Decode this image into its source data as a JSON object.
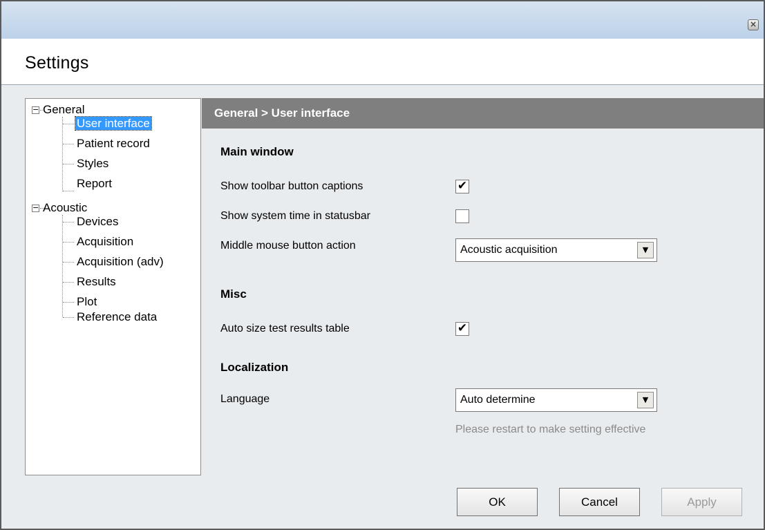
{
  "window": {
    "header_title": "Settings",
    "close_icon": "close-icon"
  },
  "tree": {
    "groups": [
      {
        "label": "General",
        "expanded": true,
        "children": [
          "User interface",
          "Patient record",
          "Styles",
          "Report"
        ]
      },
      {
        "label": "Acoustic",
        "expanded": true,
        "children": [
          "Devices",
          "Acquisition",
          "Acquisition (adv)",
          "Results",
          "Plot",
          "Reference data"
        ]
      }
    ],
    "selected": "User interface",
    "toggle_symbol": "⊟"
  },
  "panel": {
    "breadcrumb": "General > User interface",
    "sections": {
      "main_window": {
        "title": "Main window",
        "show_toolbar_captions": {
          "label": "Show toolbar button captions",
          "checked": true
        },
        "show_system_time": {
          "label": "Show system time in statusbar",
          "checked": false
        },
        "middle_mouse": {
          "label": "Middle mouse button action",
          "value": "Acoustic acquisition"
        }
      },
      "misc": {
        "title": "Misc",
        "auto_size": {
          "label": "Auto size test results table",
          "checked": true
        }
      },
      "localization": {
        "title": "Localization",
        "language": {
          "label": "Language",
          "value": "Auto determine"
        },
        "hint": "Please restart to make setting effective"
      }
    }
  },
  "buttons": {
    "ok": "OK",
    "cancel": "Cancel",
    "apply": "Apply"
  },
  "check_glyph": "✔",
  "dropdown_glyph": "▼"
}
